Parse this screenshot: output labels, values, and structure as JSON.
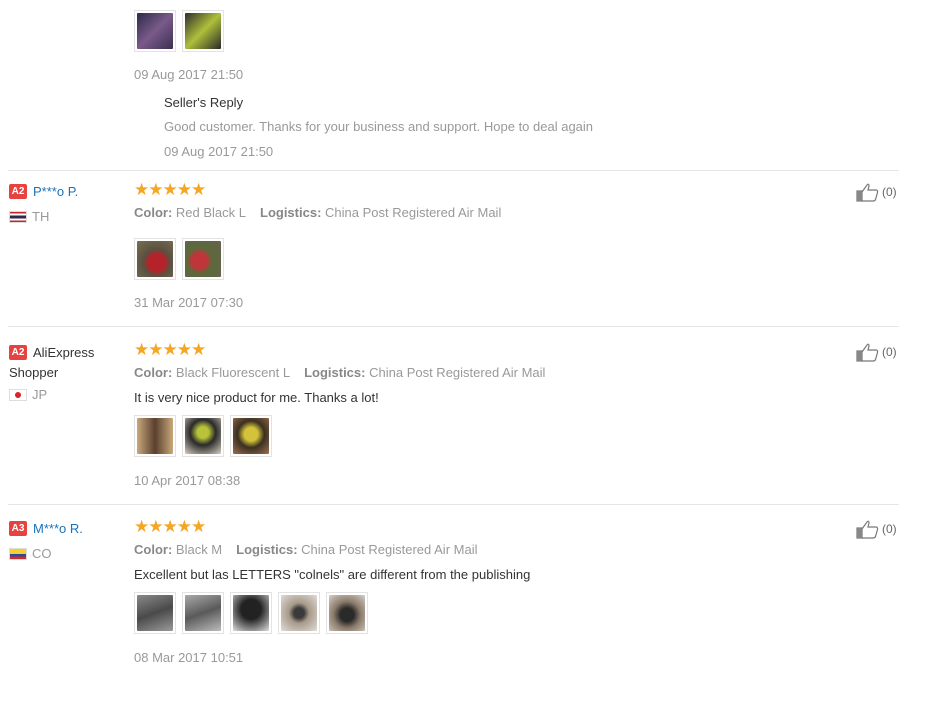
{
  "top": {
    "date": "09 Aug 2017 21:50",
    "reply": {
      "title": "Seller's Reply",
      "text": "Good customer. Thanks for your business and support. Hope to deal again",
      "date": "09 Aug 2017 21:50"
    },
    "thumb_colors": [
      "#5a4f6a",
      "#3b3f3a"
    ]
  },
  "reviews": [
    {
      "level": "A2",
      "name": "P***o P.",
      "country": "TH",
      "flag": "thumb-th",
      "color_label": "Color:",
      "color_value": "Red Black L",
      "logistics_label": "Logistics:",
      "logistics_value": "China Post Registered Air Mail",
      "comment": "",
      "date": "31 Mar 2017 07:30",
      "likes": "(0)",
      "thumb_colors": [
        "#7a2a22",
        "#6b6f4f"
      ]
    },
    {
      "level": "A2",
      "name": "AliExpress Shopper",
      "country": "JP",
      "color_label": "Color:",
      "color_value": "Black Fluorescent L",
      "logistics_label": "Logistics:",
      "logistics_value": "China Post Registered Air Mail",
      "comment": "It is very nice product for me. Thanks a lot!",
      "date": "10 Apr 2017 08:38",
      "likes": "(0)",
      "thumb_colors": [
        "#8a6a4a",
        "#3a3f30",
        "#8a7a2a"
      ]
    },
    {
      "level": "A3",
      "name": "M***o R.",
      "country": "CO",
      "color_label": "Color:",
      "color_value": "Black M",
      "logistics_label": "Logistics:",
      "logistics_value": "China Post Registered Air Mail",
      "comment": "Excellent but las LETTERS \"colnels\" are different from the publishing",
      "date": "08 Mar 2017 10:51",
      "likes": "(0)",
      "thumb_colors": [
        "#6a6a6a",
        "#7a7a7a",
        "#3a3a3a",
        "#8a7a6a",
        "#6a5a4a"
      ]
    }
  ],
  "stars": "★★★★★",
  "colors": {
    "accent_star": "#f5a623",
    "link": "#1d72b8",
    "level_badge": "#e64340"
  }
}
